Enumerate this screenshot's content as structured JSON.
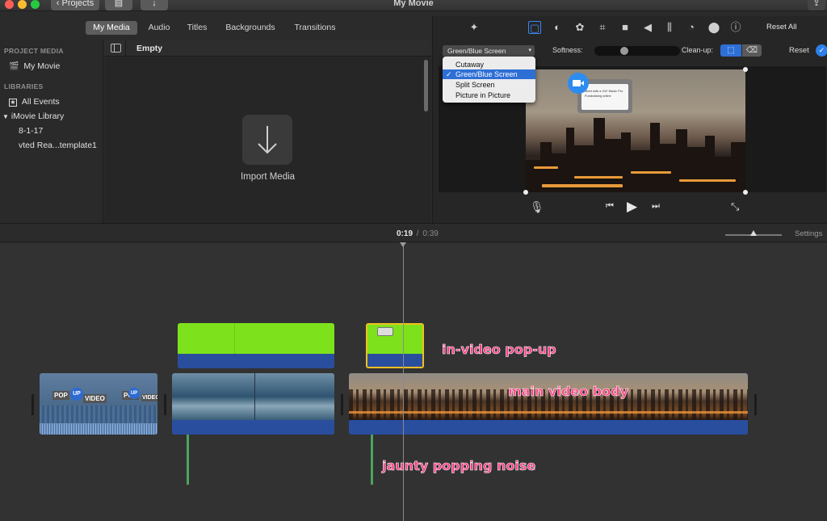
{
  "window": {
    "title": "My Movie",
    "projects_label": "Projects"
  },
  "tabs": [
    "My Media",
    "Audio",
    "Titles",
    "Backgrounds",
    "Transitions"
  ],
  "sidebar": {
    "project_media_heading": "PROJECT MEDIA",
    "project_item": "My Movie",
    "libraries_heading": "LIBRARIES",
    "all_events": "All Events",
    "library": "iMovie Library",
    "events": [
      "8-1-17",
      "vted Rea...template1"
    ]
  },
  "browser": {
    "filter_label": "Empty",
    "import_label": "Import Media"
  },
  "adjust": {
    "reset_all": "Reset All",
    "overlay_select": "Green/Blue Screen",
    "softness_label": "Softness:",
    "cleanup_label": "Clean-up:",
    "reset": "Reset",
    "overlay_options": [
      "Cutaway",
      "Green/Blue Screen",
      "Split Screen",
      "Picture in Picture"
    ],
    "selected_option": "Green/Blue Screen"
  },
  "viewer": {
    "popup_line1": "Meet with a GV! Music Pro",
    "popup_line2": "Fundraising online"
  },
  "timeline": {
    "current_time": "0:19",
    "separator": "/",
    "total_time": "0:39",
    "settings_label": "Settings",
    "clip_text_pop": "POP",
    "clip_text_up": "UP",
    "clip_text_video": "VIDEO"
  },
  "annotations": {
    "popup": "in-video pop-up",
    "main": "main video body",
    "noise": "jaunty popping noise"
  },
  "colors": {
    "green_screen": "#7de21b",
    "audio_track": "#2a4e9e",
    "annotation": "#ff3d86",
    "selection": "#2e6fd6",
    "playhead": "#8a8a8a"
  }
}
